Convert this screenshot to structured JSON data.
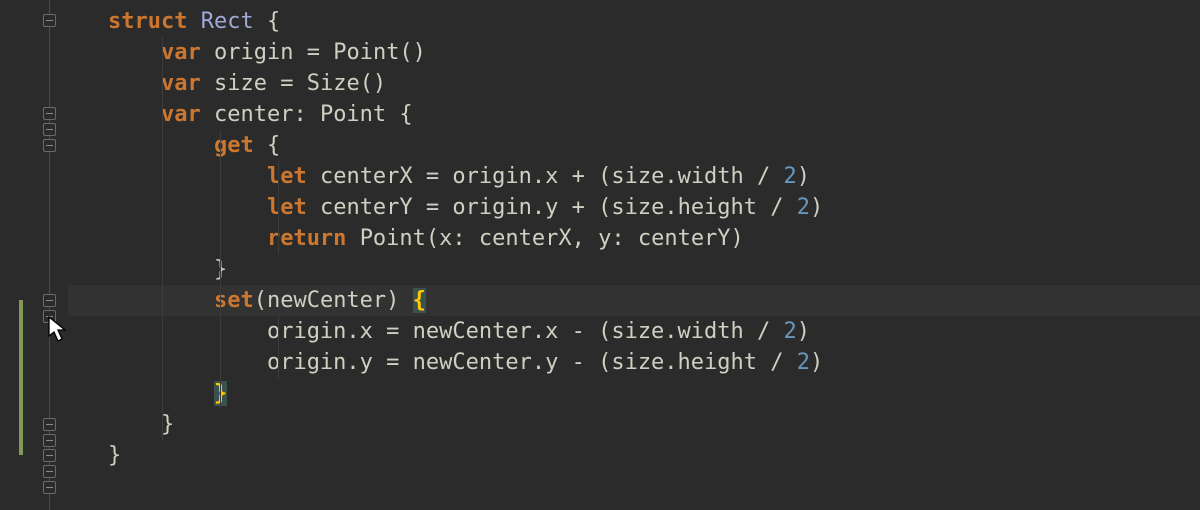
{
  "code": {
    "struct_kw": "struct",
    "rect_name": "Rect",
    "brace_open": "{",
    "brace_close": "}",
    "var_kw": "var",
    "origin_decl_name": "origin",
    "origin_decl_rhs": "= Point()",
    "size_decl_name": "size",
    "size_decl_rhs": "= Size()",
    "center_decl": "center: Point {",
    "get_kw": "get",
    "get_brace": "{",
    "let_kw": "let",
    "cx_line": "centerX = origin.x + (size.width / ",
    "cy_line": "centerY = origin.y + (size.height / ",
    "two": "2",
    "close_paren": ")",
    "return_kw": "return",
    "return_rhs": "Point(x: centerX, y: centerY)",
    "get_close": "}",
    "set_kw": "set",
    "set_args": "(newCenter) ",
    "set_open": "{",
    "set_body1": "origin.x = newCenter.x - (size.width / ",
    "set_body2": "origin.y = newCenter.y - (size.height / ",
    "set_close": "}",
    "center_close": "}",
    "struct_close": "}"
  }
}
